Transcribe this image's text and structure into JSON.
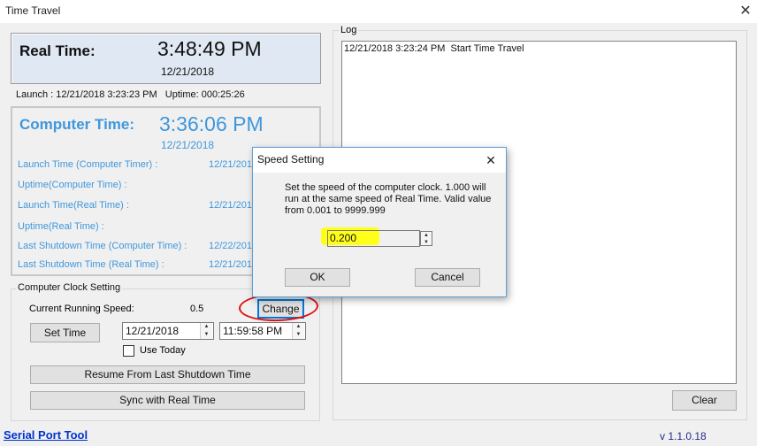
{
  "window": {
    "title": "Time Travel",
    "close_glyph": "✕"
  },
  "real_time": {
    "label": "Real Time:",
    "time": "3:48:49 PM",
    "date": "12/21/2018"
  },
  "launch_line": "Launch : 12/21/2018 3:23:23 PM   Uptime: 000:25:26",
  "computer_time": {
    "label": "Computer Time:",
    "time": "3:36:06 PM",
    "date": "12/21/2018",
    "rows": [
      {
        "label": "Launch Time (Computer Timer) :",
        "value": "12/21/201"
      },
      {
        "label": "Uptime(Computer Time) :",
        "value": ""
      },
      {
        "label": "Launch Time(Real Time) :",
        "value": "12/21/201"
      },
      {
        "label": "Uptime(Real Time) :",
        "value": ""
      },
      {
        "label": "Last Shutdown Time (Computer Time) :",
        "value": "12/22/201"
      },
      {
        "label": "Last Shutdown Time (Real Time) :",
        "value": "12/21/201"
      }
    ]
  },
  "clock_setting": {
    "group_title": "Computer Clock Setting",
    "speed_label": "Current Running Speed:",
    "speed_value": "0.5",
    "change_button": "Change",
    "set_time_button": "Set Time",
    "date_value": "12/21/2018",
    "time_value": "11:59:58 PM",
    "use_today_label": "Use Today",
    "use_today_checked": false,
    "resume_button": "Resume From Last Shutdown Time",
    "sync_button": "Sync with Real Time"
  },
  "log": {
    "title": "Log",
    "entries": [
      "12/21/2018 3:23:24 PM  Start Time Travel"
    ],
    "clear_button": "Clear"
  },
  "footer": {
    "link": "Serial Port Tool",
    "version": "v 1.1.0.18"
  },
  "dialog": {
    "title": "Speed Setting",
    "close_glyph": "✕",
    "message": "Set the speed of the computer clock. 1.000 will run at the same speed of Real Time. Valid value from 0.001 to 9999.999",
    "value": "0.200",
    "ok_button": "OK",
    "cancel_button": "Cancel"
  },
  "colors": {
    "accent_blue": "#3f97dc",
    "real_panel_bg": "#dfe8f3",
    "annotation_red": "#e01010",
    "highlight_yellow": "#ffff1a",
    "link_blue": "#0033cc"
  }
}
